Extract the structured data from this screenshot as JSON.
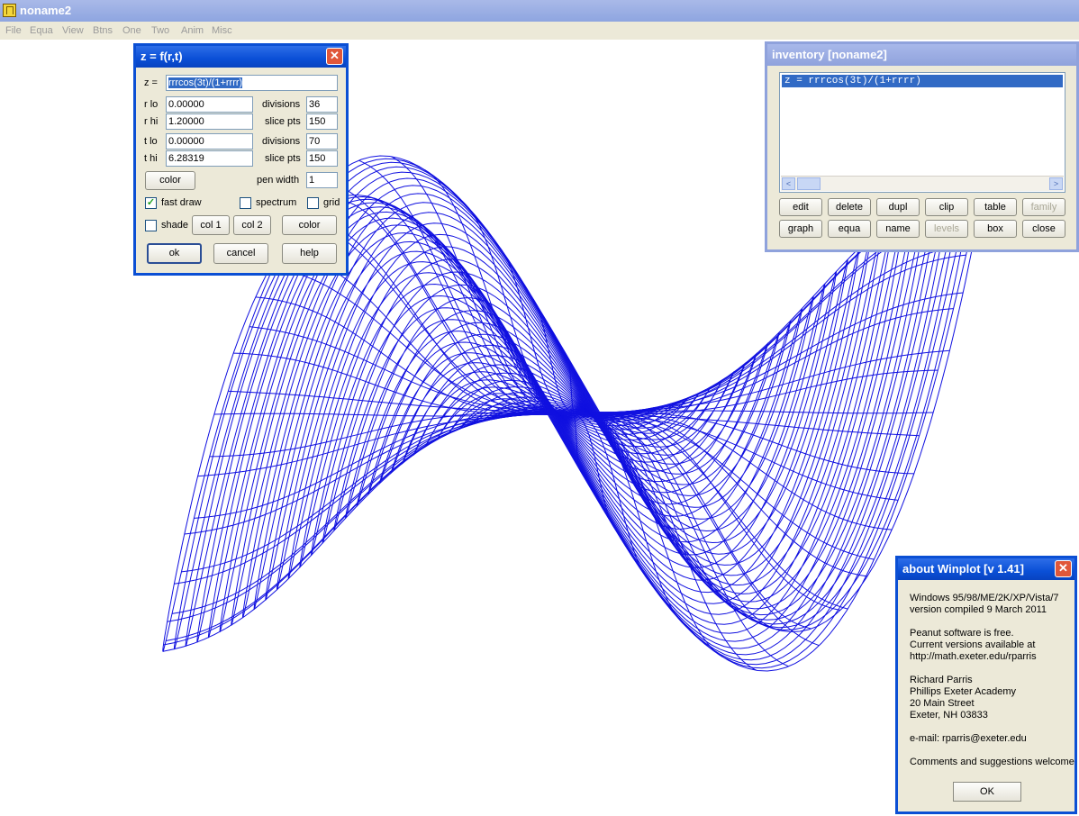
{
  "app": {
    "title": "noname2"
  },
  "menu": [
    "File",
    "Equa",
    "View",
    "Btns",
    "One",
    "Two",
    "Anim",
    "Misc"
  ],
  "dialog": {
    "title": "z = f(r,t)",
    "z_label": "z =",
    "z_value": "rrrcos(3t)/(1+rrrr)",
    "r_lo_label": "r lo",
    "r_lo": "0.00000",
    "r_hi_label": "r hi",
    "r_hi": "1.20000",
    "t_lo_label": "t lo",
    "t_lo": "0.00000",
    "t_hi_label": "t hi",
    "t_hi": "6.28319",
    "r_div_label": "divisions",
    "r_div": "36",
    "r_slice_label": "slice pts",
    "r_slice": "150",
    "t_div_label": "divisions",
    "t_div": "70",
    "t_slice_label": "slice pts",
    "t_slice": "150",
    "pen_width_label": "pen width",
    "pen_width": "1",
    "color_button": "color",
    "fast_draw_label": "fast draw",
    "fast_draw_checked": true,
    "spectrum_label": "spectrum",
    "spectrum_checked": false,
    "grid_label": "grid",
    "grid_checked": false,
    "shade_label": "shade",
    "shade_checked": false,
    "col1_button": "col 1",
    "col2_button": "col 2",
    "color2_button": "color",
    "ok_button": "ok",
    "cancel_button": "cancel",
    "help_button": "help",
    "close_glyph": "✕"
  },
  "inventory": {
    "title": "inventory  [noname2]",
    "items": [
      "z = rrrcos(3t)/(1+rrrr)"
    ],
    "buttons_row1": [
      "edit",
      "delete",
      "dupl",
      "clip",
      "table",
      "family"
    ],
    "buttons_row2": [
      "graph",
      "equa",
      "name",
      "levels",
      "box",
      "close"
    ],
    "disabled": [
      "family",
      "levels"
    ],
    "scroll_left": "<",
    "scroll_right": ">"
  },
  "about": {
    "title": "about Winplot [v 1.41]",
    "close_glyph": "✕",
    "lines": [
      "Windows 95/98/ME/2K/XP/Vista/7",
      "version compiled 9 March 2011",
      "",
      "Peanut software is free.",
      "Current versions available at",
      "http://math.exeter.edu/rparris",
      "",
      "Richard Parris",
      "Phillips Exeter Academy",
      "20 Main Street",
      "Exeter, NH    03833",
      "",
      "e-mail: rparris@exeter.edu",
      "",
      "Comments and suggestions welcome"
    ],
    "ok_button": "OK"
  },
  "plot": {
    "function": "z = rrrcos(3t)/(1+rrrr)",
    "r_range": [
      0.0,
      1.2
    ],
    "t_range": [
      0.0,
      6.28319
    ],
    "r_divisions": 36,
    "t_divisions": 70,
    "line_color": "#1010e0"
  }
}
